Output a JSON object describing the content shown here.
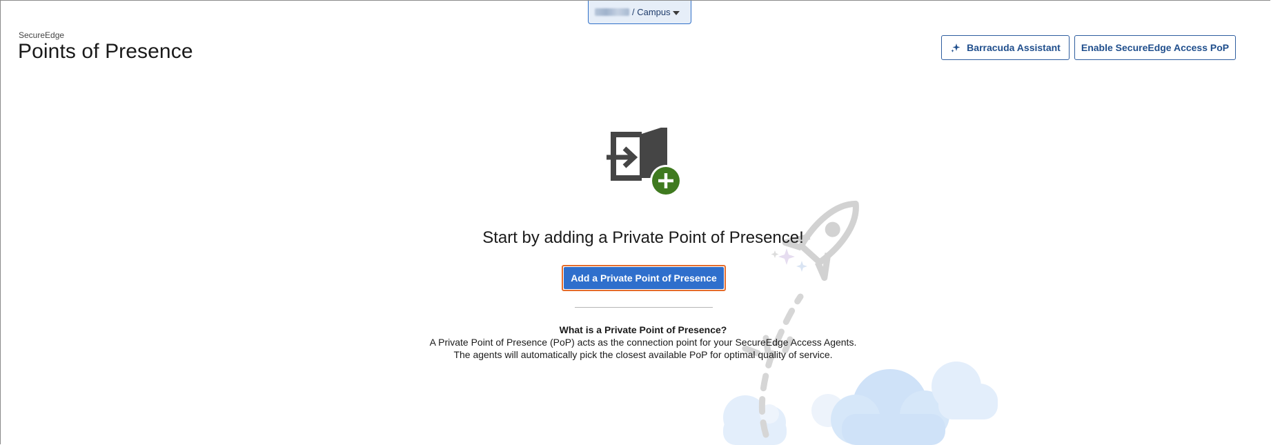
{
  "tenant_switcher": {
    "label": "/ Campus",
    "caret_icon": "chevron-down-icon"
  },
  "header": {
    "app_name": "SecureEdge",
    "page_title": "Points of Presence",
    "assistant_button": "Barracuda Assistant",
    "assistant_icon": "sparkle-icon",
    "enable_button": "Enable SecureEdge Access PoP"
  },
  "empty_state": {
    "icon": "door-enter-add-icon",
    "headline": "Start by adding a Private Point of Presence!",
    "add_button": "Add a Private Point of Presence",
    "info_title": "What is a Private Point of Presence?",
    "info_line_1": "A Private Point of Presence (PoP) acts as the connection point for your SecureEdge Access Agents.",
    "info_line_2": "The agents will automatically pick the closest available PoP for optimal quality of service."
  },
  "colors": {
    "primary": "#2f6fcc",
    "accent_border": "#e46b2a",
    "add_badge": "#3f7a1f",
    "outline_button": "#1f4e8c"
  },
  "decoration": {
    "illustration": "rocket-launch-clouds-illustration"
  }
}
